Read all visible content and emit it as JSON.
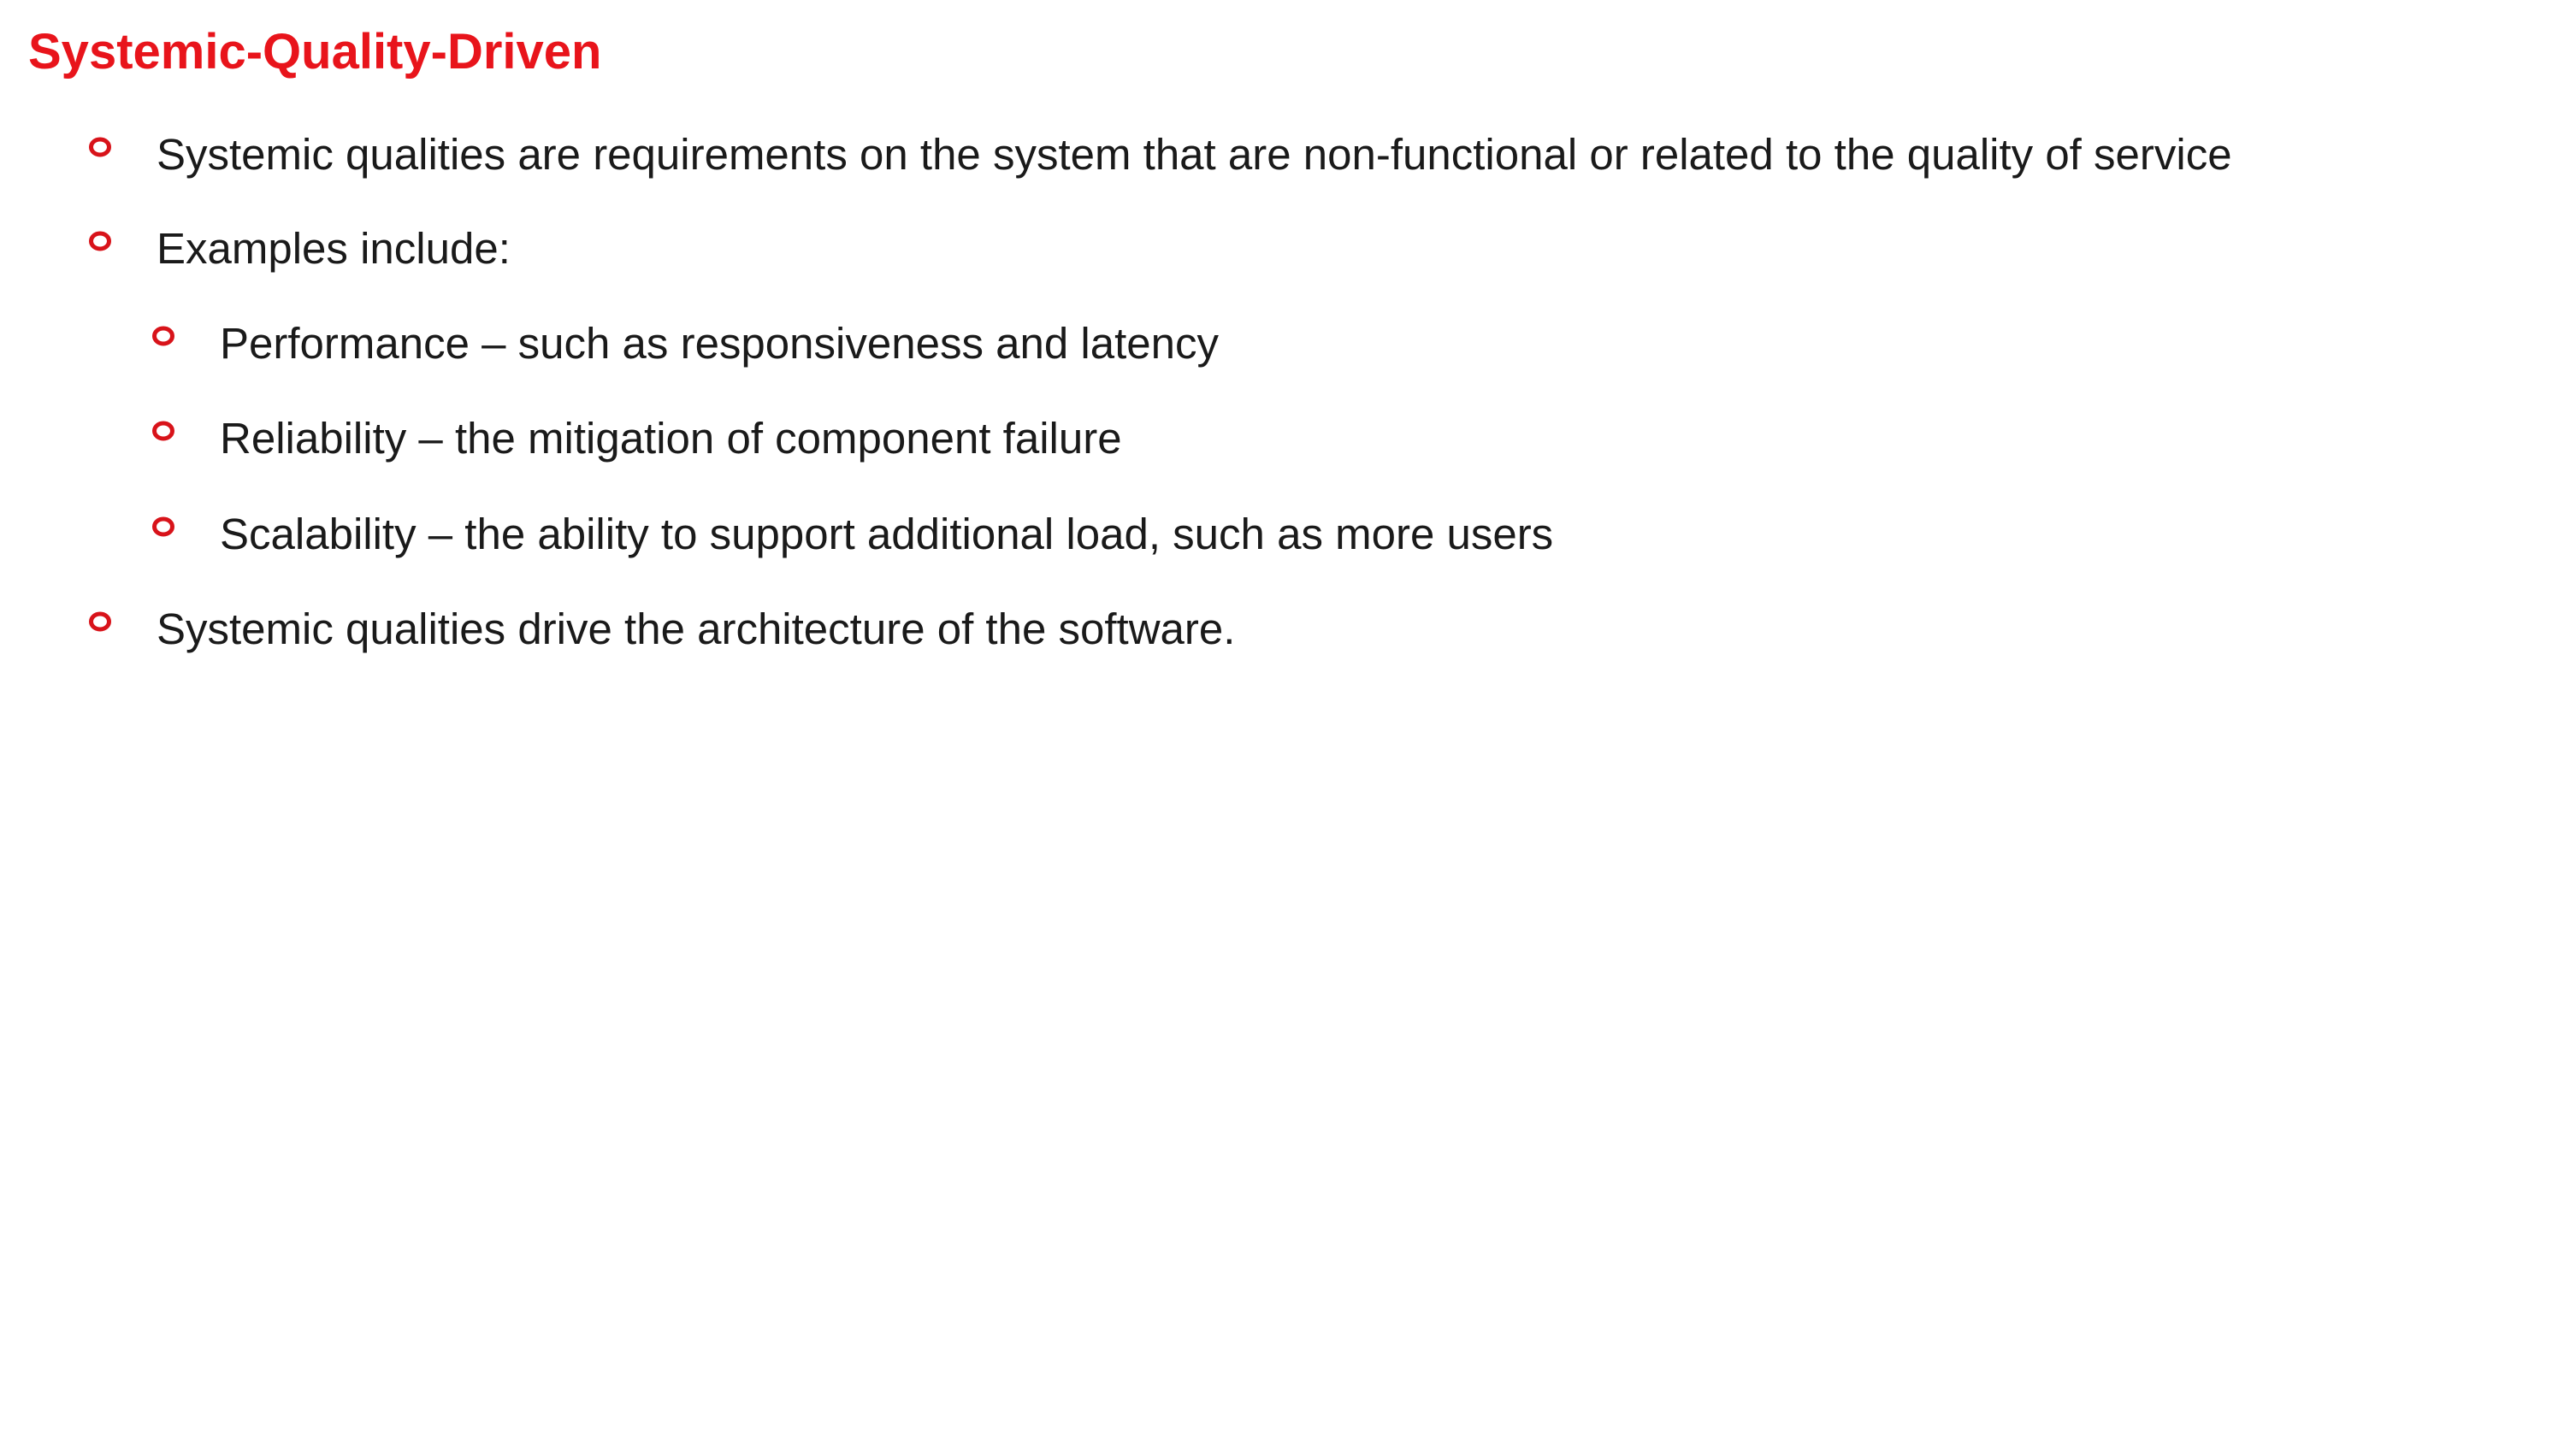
{
  "slide": {
    "title": "Systemic-Quality-Driven",
    "accent_color": "#e8141b",
    "bullet_icon": "red-ring-bullet-icon",
    "bullets": [
      {
        "level": 1,
        "text": "Systemic qualities are requirements on the system that are non-functional or related to the quality of service"
      },
      {
        "level": 1,
        "text": "Examples include:"
      },
      {
        "level": 2,
        "text": "Performance – such as responsiveness and latency"
      },
      {
        "level": 2,
        "text": "Reliability – the mitigation of component failure"
      },
      {
        "level": 2,
        "text": "Scalability – the ability to support additional load, such as more users"
      },
      {
        "level": 1,
        "text": "Systemic qualities drive the architecture of the software."
      }
    ]
  }
}
